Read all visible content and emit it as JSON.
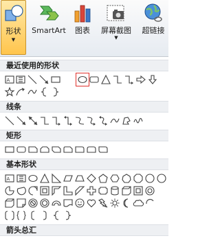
{
  "ribbon": {
    "shapes_label": "形状",
    "smartart_label": "SmartArt",
    "chart_label": "图表",
    "screenshot_label": "屏幕截图",
    "hyperlink_label": "超链接",
    "accent": "#ffc54d"
  },
  "gallery": {
    "sections": [
      {
        "title": "最近使用的形状"
      },
      {
        "title": "线条"
      },
      {
        "title": "矩形"
      },
      {
        "title": "基本形状"
      },
      {
        "title": "箭头总汇"
      }
    ],
    "selected_shape": "oval",
    "selection_color": "#e0302b"
  }
}
